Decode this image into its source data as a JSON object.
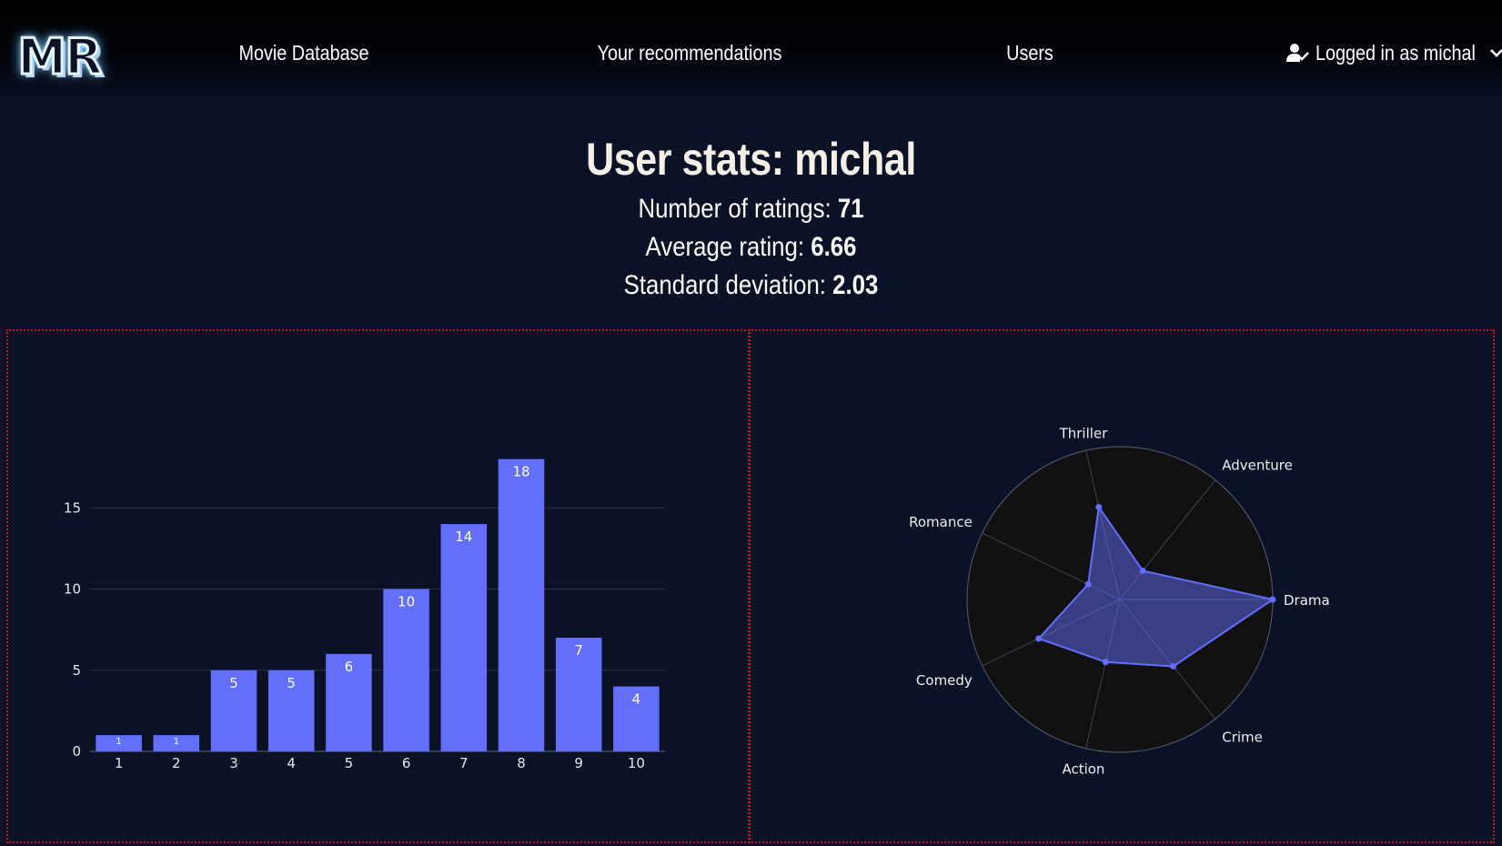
{
  "navbar": {
    "logo_text": "MR",
    "links": [
      "Movie Database",
      "Your recommendations",
      "Users"
    ],
    "user_menu_label": "Logged in as michal",
    "user_icon": "user-check-icon",
    "dropdown_icon": "chevron-down-icon"
  },
  "page": {
    "title": "User stats: michal",
    "stats": [
      {
        "label": "Number of ratings:",
        "value": "71"
      },
      {
        "label": "Average rating:",
        "value": "6.66"
      },
      {
        "label": "Standard deviation:",
        "value": "2.03"
      }
    ]
  },
  "colors": {
    "background": "#0b1226",
    "accent": "#636efa",
    "panel_border": "#c3162a",
    "radar_bg": "#111111",
    "grid": "#2a3346"
  },
  "chart_data": [
    {
      "type": "bar",
      "categories": [
        "1",
        "2",
        "3",
        "4",
        "5",
        "6",
        "7",
        "8",
        "9",
        "10"
      ],
      "values": [
        1,
        1,
        5,
        5,
        6,
        10,
        14,
        18,
        7,
        4
      ],
      "ylim": [
        0,
        19
      ],
      "yticks": [
        0,
        5,
        10,
        15
      ],
      "grid": true,
      "data_labels": true
    },
    {
      "type": "radar",
      "categories": [
        "Drama",
        "Adventure",
        "Thriller",
        "Romance",
        "Comedy",
        "Action",
        "Crime"
      ],
      "values": [
        1.0,
        0.24,
        0.62,
        0.23,
        0.59,
        0.42,
        0.56
      ],
      "rlim": [
        0,
        1
      ],
      "grid": true
    }
  ]
}
